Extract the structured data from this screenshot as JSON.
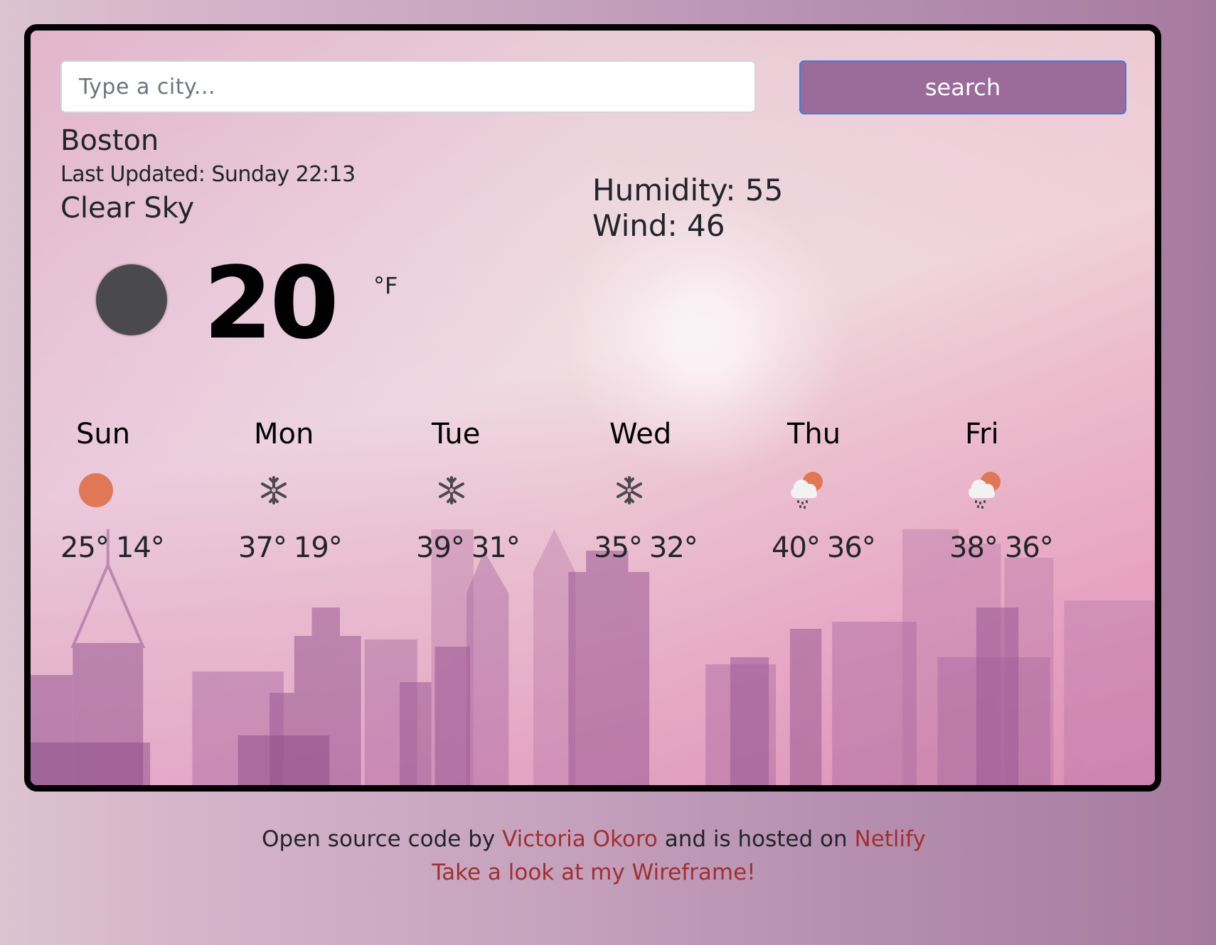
{
  "search": {
    "placeholder": "Type a city...",
    "value": "",
    "button_label": "search"
  },
  "current": {
    "city": "Boston",
    "last_updated": "Last Updated: Sunday 22:13",
    "description": "Clear Sky",
    "icon": "clear-night-icon",
    "temperature": "20",
    "unit": "°F",
    "humidity": "Humidity: 55",
    "wind": "Wind: 46"
  },
  "forecast": [
    {
      "day": "Sun",
      "icon": "sun-icon",
      "high": "25°",
      "low": "14°"
    },
    {
      "day": "Mon",
      "icon": "snowflake-icon",
      "high": "37°",
      "low": "19°"
    },
    {
      "day": "Tue",
      "icon": "snowflake-icon",
      "high": "39°",
      "low": "31°"
    },
    {
      "day": "Wed",
      "icon": "snowflake-icon",
      "high": "35°",
      "low": "32°"
    },
    {
      "day": "Thu",
      "icon": "rain-cloud-sun-icon",
      "high": "40°",
      "low": "36°"
    },
    {
      "day": "Fri",
      "icon": "rain-cloud-sun-icon",
      "high": "38°",
      "low": "36°"
    }
  ],
  "footer": {
    "text_before": "Open source code by ",
    "author_link": "Victoria Okoro",
    "text_middle": " and is hosted on ",
    "host_link": "Netlify",
    "wireframe_link": "Take a look at my Wireframe!"
  },
  "colors": {
    "button_bg": "#9b6b9a",
    "button_border": "#3b7ddd",
    "link": "#a0302f",
    "sun_icon": "#e07856",
    "night_icon": "#4a4a4c",
    "icon_gray": "#4a4a4c"
  }
}
